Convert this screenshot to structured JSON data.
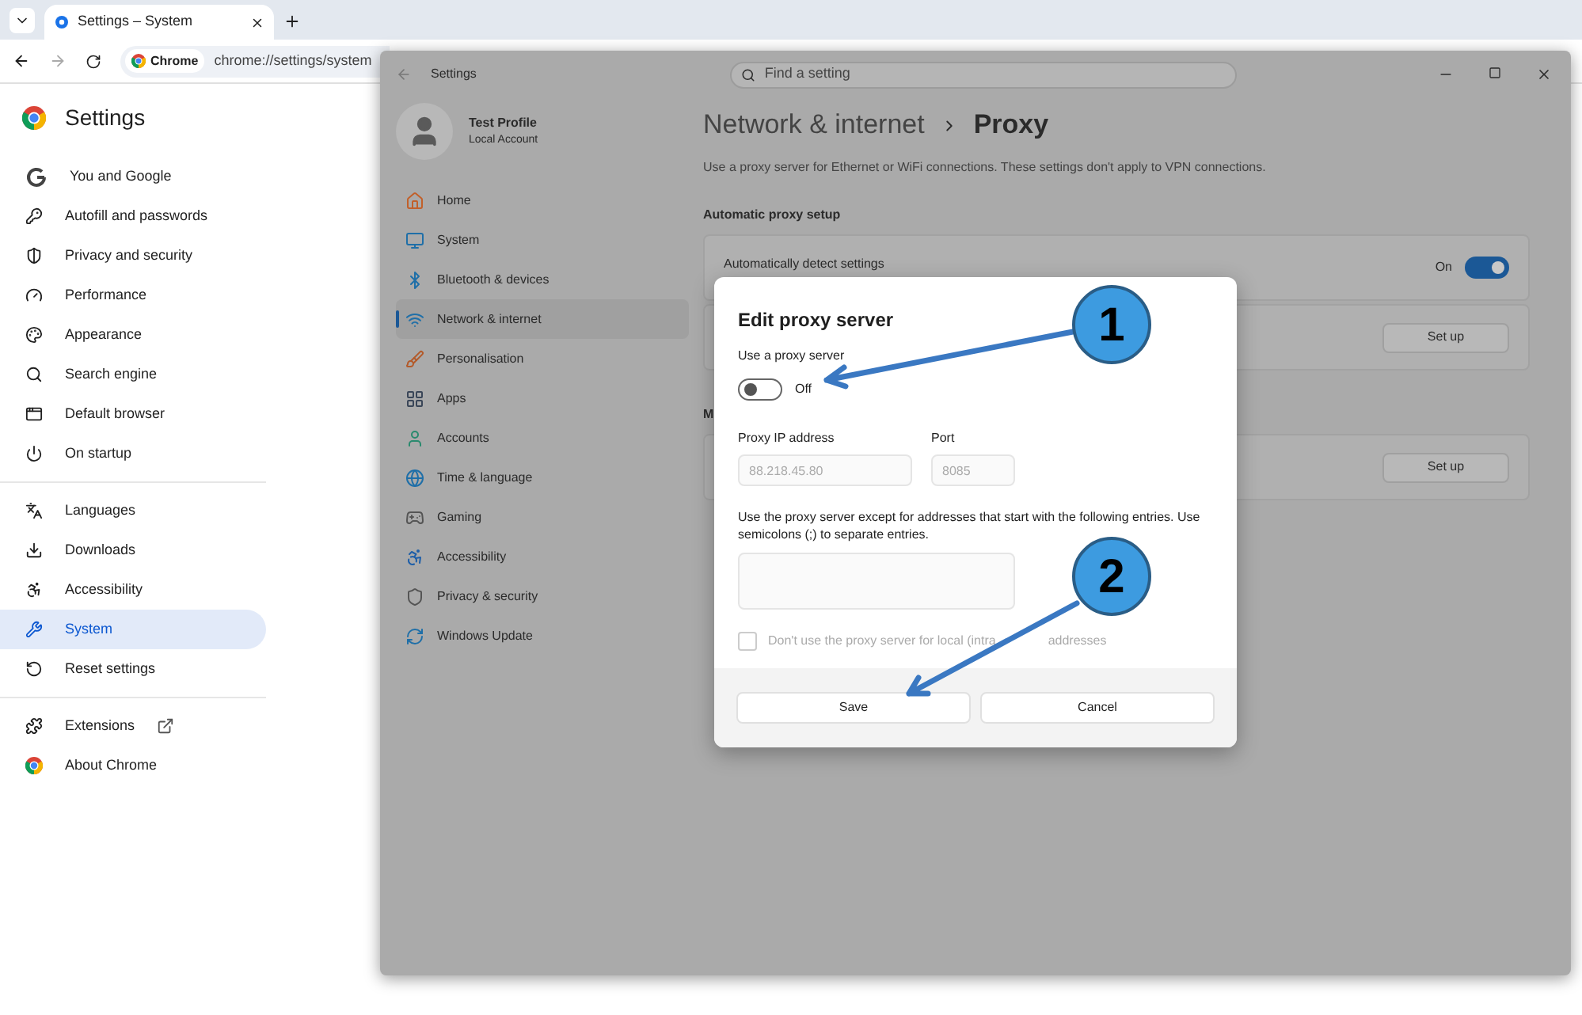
{
  "browser": {
    "tab_title": "Settings – System",
    "chip": "Chrome",
    "url": "chrome://settings/system"
  },
  "chrome_settings": {
    "title": "Settings",
    "groups": [
      [
        {
          "label": "You and Google",
          "selected": false
        },
        {
          "label": "Autofill and passwords",
          "selected": false
        },
        {
          "label": "Privacy and security",
          "selected": false
        },
        {
          "label": "Performance",
          "selected": false
        },
        {
          "label": "Appearance",
          "selected": false
        },
        {
          "label": "Search engine",
          "selected": false
        },
        {
          "label": "Default browser",
          "selected": false
        },
        {
          "label": "On startup",
          "selected": false
        }
      ],
      [
        {
          "label": "Languages",
          "selected": false
        },
        {
          "label": "Downloads",
          "selected": false
        },
        {
          "label": "Accessibility",
          "selected": false
        },
        {
          "label": "System",
          "selected": true
        },
        {
          "label": "Reset settings",
          "selected": false
        }
      ],
      [
        {
          "label": "Extensions",
          "selected": false
        },
        {
          "label": "About Chrome",
          "selected": false
        }
      ]
    ]
  },
  "windows_settings": {
    "title": "Settings",
    "search": {
      "placeholder": "Find a setting"
    },
    "profile": {
      "name": "Test Profile",
      "account": "Local Account"
    },
    "nav": [
      {
        "label": "Home",
        "selected": false
      },
      {
        "label": "System",
        "selected": false
      },
      {
        "label": "Bluetooth & devices",
        "selected": false
      },
      {
        "label": "Network & internet",
        "selected": true
      },
      {
        "label": "Personalisation",
        "selected": false
      },
      {
        "label": "Apps",
        "selected": false
      },
      {
        "label": "Accounts",
        "selected": false
      },
      {
        "label": "Time & language",
        "selected": false
      },
      {
        "label": "Gaming",
        "selected": false
      },
      {
        "label": "Accessibility",
        "selected": false
      },
      {
        "label": "Privacy & security",
        "selected": false
      },
      {
        "label": "Windows Update",
        "selected": false
      }
    ],
    "breadcrumb": {
      "parent": "Network & internet",
      "current": "Proxy"
    },
    "description": "Use a proxy server for Ethernet or WiFi connections. These settings don't apply to VPN connections.",
    "sections": [
      {
        "heading": "Automatic proxy setup",
        "rows": [
          {
            "kind": "toggle",
            "label": "Automatically detect settings",
            "on": true,
            "state_label": "On"
          },
          {
            "kind": "button",
            "button": "Set up"
          }
        ]
      },
      {
        "heading": "M",
        "rows": [
          {
            "kind": "button",
            "button": "Set up"
          }
        ]
      }
    ]
  },
  "dialog": {
    "title": "Edit proxy server",
    "toggle_label": "Use a proxy server",
    "toggle": {
      "on": false,
      "state_label": "Off"
    },
    "ip": {
      "label": "Proxy IP address",
      "value": "88.218.45.80",
      "disabled": true
    },
    "port": {
      "label": "Port",
      "value": "8085",
      "disabled": true
    },
    "exceptions_label": "Use the proxy server except for addresses that start with the following entries. Use semicolons (;) to separate entries.",
    "local_checkbox": {
      "label": "Don't use the proxy server for local (intra",
      "label_end": "addresses",
      "checked": false,
      "disabled": true
    },
    "buttons": [
      "Save",
      "Cancel"
    ]
  },
  "callouts": [
    "1",
    "2"
  ]
}
